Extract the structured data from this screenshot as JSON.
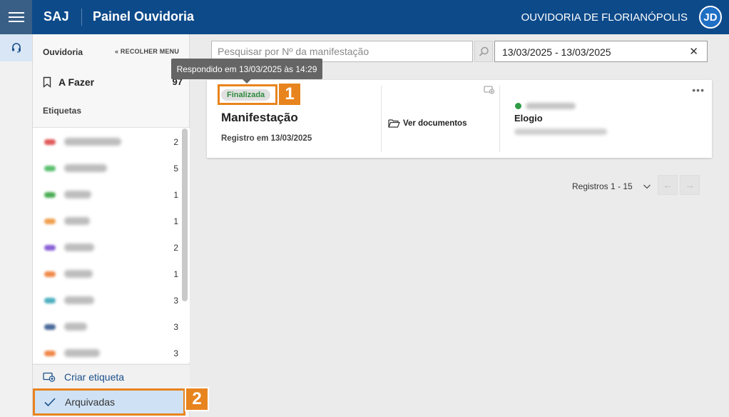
{
  "header": {
    "brand": "SAJ",
    "title": "Painel Ouvidoria",
    "org": "OUVIDORIA DE FLORIANÓPOLIS",
    "avatar_initials": "JD",
    "bg_color": "#0d4a8a"
  },
  "sidebar": {
    "title": "Ouvidoria",
    "collapse_label": "RECOLHER MENU",
    "todo": {
      "label": "A Fazer",
      "count": "97"
    },
    "tags_title": "Etiquetas",
    "tags": [
      {
        "color": "#e05a5a",
        "count": "2"
      },
      {
        "color": "#5cc070",
        "count": "5"
      },
      {
        "color": "#4cae56",
        "count": "1"
      },
      {
        "color": "#f0a050",
        "count": "1"
      },
      {
        "color": "#8a62d6",
        "count": "2"
      },
      {
        "color": "#f08a4a",
        "count": "1"
      },
      {
        "color": "#4fb0c0",
        "count": "3"
      },
      {
        "color": "#4a6a9a",
        "count": "3"
      },
      {
        "color": "#f0884a",
        "count": "3"
      }
    ],
    "create_tag_label": "Criar etiqueta",
    "archived_label": "Arquivadas"
  },
  "search": {
    "placeholder": "Pesquisar por Nº da manifestação",
    "date_range": "13/03/2025 - 13/03/2025"
  },
  "card": {
    "status": "Finalizada",
    "title": "Manifestação",
    "registered": "Registro em 13/03/2025",
    "documents_label": "Ver documentos",
    "type": "Elogio",
    "more": "•••"
  },
  "tooltip": "Respondido em 13/03/2025 às 14:29",
  "pagination": {
    "records": "Registros 1 - 15",
    "prev": "←",
    "next": "→"
  },
  "callouts": {
    "one": "1",
    "two": "2",
    "color": "#e8841e"
  }
}
